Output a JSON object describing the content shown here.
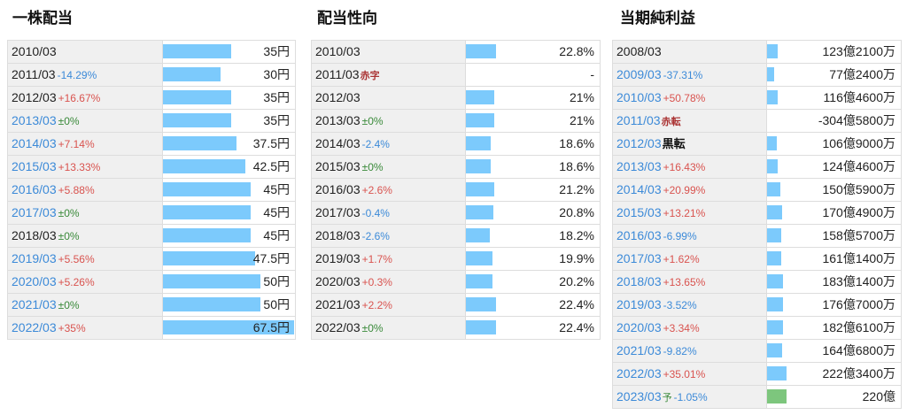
{
  "dividend": {
    "title": "一株配当",
    "rows": [
      {
        "year": "2010/03",
        "chg": "",
        "chg_type": "",
        "value": "35円",
        "ratio": 0.52,
        "year_blue": false
      },
      {
        "year": "2011/03",
        "chg": "-14.29%",
        "chg_type": "dn",
        "value": "30円",
        "ratio": 0.44,
        "year_blue": false
      },
      {
        "year": "2012/03",
        "chg": "+16.67%",
        "chg_type": "up",
        "value": "35円",
        "ratio": 0.52,
        "year_blue": false
      },
      {
        "year": "2013/03",
        "chg": "±0%",
        "chg_type": "zero",
        "value": "35円",
        "ratio": 0.52,
        "year_blue": true
      },
      {
        "year": "2014/03",
        "chg": "+7.14%",
        "chg_type": "up",
        "value": "37.5円",
        "ratio": 0.56,
        "year_blue": true
      },
      {
        "year": "2015/03",
        "chg": "+13.33%",
        "chg_type": "up",
        "value": "42.5円",
        "ratio": 0.63,
        "year_blue": true
      },
      {
        "year": "2016/03",
        "chg": "+5.88%",
        "chg_type": "up",
        "value": "45円",
        "ratio": 0.67,
        "year_blue": true
      },
      {
        "year": "2017/03",
        "chg": "±0%",
        "chg_type": "zero",
        "value": "45円",
        "ratio": 0.67,
        "year_blue": true
      },
      {
        "year": "2018/03",
        "chg": "±0%",
        "chg_type": "zero",
        "value": "45円",
        "ratio": 0.67,
        "year_blue": false
      },
      {
        "year": "2019/03",
        "chg": "+5.56%",
        "chg_type": "up",
        "value": "47.5円",
        "ratio": 0.7,
        "year_blue": true
      },
      {
        "year": "2020/03",
        "chg": "+5.26%",
        "chg_type": "up",
        "value": "50円",
        "ratio": 0.74,
        "year_blue": true
      },
      {
        "year": "2021/03",
        "chg": "±0%",
        "chg_type": "zero",
        "value": "50円",
        "ratio": 0.74,
        "year_blue": true
      },
      {
        "year": "2022/03",
        "chg": "+35%",
        "chg_type": "up",
        "value": "67.5円",
        "ratio": 1.0,
        "year_blue": true
      }
    ]
  },
  "payout": {
    "title": "配当性向",
    "rows": [
      {
        "year": "2010/03",
        "chg": "",
        "chg_type": "",
        "value": "22.8%",
        "ratio": 0.228,
        "tag": ""
      },
      {
        "year": "2011/03",
        "chg": "",
        "chg_type": "",
        "value": "-",
        "ratio": 0,
        "tag": "赤字"
      },
      {
        "year": "2012/03",
        "chg": "",
        "chg_type": "",
        "value": "21%",
        "ratio": 0.21,
        "tag": ""
      },
      {
        "year": "2013/03",
        "chg": "±0%",
        "chg_type": "zero",
        "value": "21%",
        "ratio": 0.21,
        "tag": ""
      },
      {
        "year": "2014/03",
        "chg": "-2.4%",
        "chg_type": "dn",
        "value": "18.6%",
        "ratio": 0.186,
        "tag": ""
      },
      {
        "year": "2015/03",
        "chg": "±0%",
        "chg_type": "zero",
        "value": "18.6%",
        "ratio": 0.186,
        "tag": ""
      },
      {
        "year": "2016/03",
        "chg": "+2.6%",
        "chg_type": "up",
        "value": "21.2%",
        "ratio": 0.212,
        "tag": ""
      },
      {
        "year": "2017/03",
        "chg": "-0.4%",
        "chg_type": "dn",
        "value": "20.8%",
        "ratio": 0.208,
        "tag": ""
      },
      {
        "year": "2018/03",
        "chg": "-2.6%",
        "chg_type": "dn",
        "value": "18.2%",
        "ratio": 0.182,
        "tag": ""
      },
      {
        "year": "2019/03",
        "chg": "+1.7%",
        "chg_type": "up",
        "value": "19.9%",
        "ratio": 0.199,
        "tag": ""
      },
      {
        "year": "2020/03",
        "chg": "+0.3%",
        "chg_type": "up",
        "value": "20.2%",
        "ratio": 0.202,
        "tag": ""
      },
      {
        "year": "2021/03",
        "chg": "+2.2%",
        "chg_type": "up",
        "value": "22.4%",
        "ratio": 0.224,
        "tag": ""
      },
      {
        "year": "2022/03",
        "chg": "±0%",
        "chg_type": "zero",
        "value": "22.4%",
        "ratio": 0.224,
        "tag": ""
      }
    ]
  },
  "net_income": {
    "title": "当期純利益",
    "rows": [
      {
        "year": "2008/03",
        "chg": "",
        "chg_type": "",
        "value": "123億2100万",
        "ratio": 0.123,
        "tag": "",
        "year_blue": false,
        "forecast": false
      },
      {
        "year": "2009/03",
        "chg": "-37.31%",
        "chg_type": "dn",
        "value": "77億2400万",
        "ratio": 0.077,
        "tag": "",
        "year_blue": true,
        "forecast": false
      },
      {
        "year": "2010/03",
        "chg": "+50.78%",
        "chg_type": "up",
        "value": "116億4600万",
        "ratio": 0.116,
        "tag": "",
        "year_blue": true,
        "forecast": false
      },
      {
        "year": "2011/03",
        "chg": "",
        "chg_type": "",
        "value": "-304億5800万",
        "ratio": 0,
        "tag": "赤転",
        "tag_type": "red",
        "year_blue": true,
        "forecast": false
      },
      {
        "year": "2012/03",
        "chg": "",
        "chg_type": "",
        "value": "106億9000万",
        "ratio": 0.107,
        "tag": "黒転",
        "tag_type": "black",
        "year_blue": true,
        "forecast": false
      },
      {
        "year": "2013/03",
        "chg": "+16.43%",
        "chg_type": "up",
        "value": "124億4600万",
        "ratio": 0.124,
        "tag": "",
        "year_blue": true,
        "forecast": false
      },
      {
        "year": "2014/03",
        "chg": "+20.99%",
        "chg_type": "up",
        "value": "150億5900万",
        "ratio": 0.151,
        "tag": "",
        "year_blue": true,
        "forecast": false
      },
      {
        "year": "2015/03",
        "chg": "+13.21%",
        "chg_type": "up",
        "value": "170億4900万",
        "ratio": 0.17,
        "tag": "",
        "year_blue": true,
        "forecast": false
      },
      {
        "year": "2016/03",
        "chg": "-6.99%",
        "chg_type": "dn",
        "value": "158億5700万",
        "ratio": 0.159,
        "tag": "",
        "year_blue": true,
        "forecast": false
      },
      {
        "year": "2017/03",
        "chg": "+1.62%",
        "chg_type": "up",
        "value": "161億1400万",
        "ratio": 0.161,
        "tag": "",
        "year_blue": true,
        "forecast": false
      },
      {
        "year": "2018/03",
        "chg": "+13.65%",
        "chg_type": "up",
        "value": "183億1400万",
        "ratio": 0.183,
        "tag": "",
        "year_blue": true,
        "forecast": false
      },
      {
        "year": "2019/03",
        "chg": "-3.52%",
        "chg_type": "dn",
        "value": "176億7000万",
        "ratio": 0.177,
        "tag": "",
        "year_blue": true,
        "forecast": false
      },
      {
        "year": "2020/03",
        "chg": "+3.34%",
        "chg_type": "up",
        "value": "182億6100万",
        "ratio": 0.183,
        "tag": "",
        "year_blue": true,
        "forecast": false
      },
      {
        "year": "2021/03",
        "chg": "-9.82%",
        "chg_type": "dn",
        "value": "164億6800万",
        "ratio": 0.165,
        "tag": "",
        "year_blue": true,
        "forecast": false
      },
      {
        "year": "2022/03",
        "chg": "+35.01%",
        "chg_type": "up",
        "value": "222億3400万",
        "ratio": 0.222,
        "tag": "",
        "year_blue": true,
        "forecast": false
      },
      {
        "year": "2023/03",
        "chg": "-1.05%",
        "chg_type": "dn",
        "value": "220億",
        "ratio": 0.22,
        "tag": "予",
        "tag_type": "green",
        "year_blue": true,
        "forecast": true
      }
    ]
  },
  "colors": {
    "bar": "#7ccafc",
    "forecast_bar": "#7dc67d",
    "up": "#d9534f",
    "down": "#3c8ad8",
    "zero": "#3a8a3a"
  }
}
